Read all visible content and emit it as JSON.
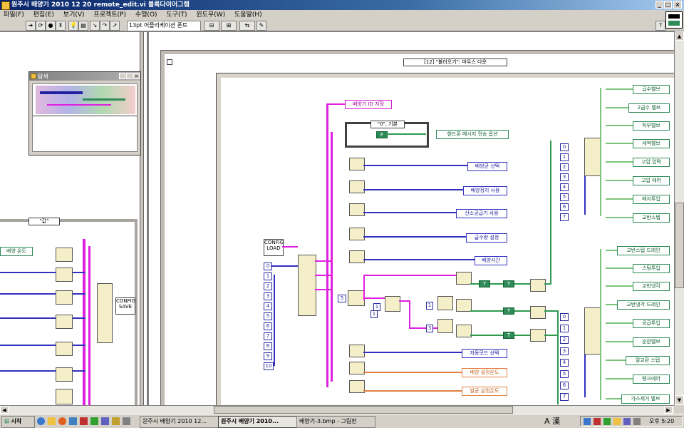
{
  "window": {
    "title": "원주시 배양기 2010 12 20 remote_edit.vi 블록다이어그램"
  },
  "menu": {
    "items": [
      "파일(F)",
      "편집(E)",
      "보기(V)",
      "프로젝트(P)",
      "수행(O)",
      "도구(T)",
      "윈도우(W)",
      "도움말(H)"
    ]
  },
  "toolbar": {
    "font_combo": "13pt 어플리케이션 폰트"
  },
  "nav_window": {
    "title": "탐색"
  },
  "diagram": {
    "left_case_selector": "\"값\"",
    "left_label_indicator": "배양 온도",
    "config_save": "CONFIG SAVE",
    "event_selector": "[12] \"불러오기\": 마우스 다운",
    "inner_case_selector": "\"0\", 기본",
    "config_load": "CONFIG LOAD",
    "indicators": {
      "id_setting": "배양기 ID 지정",
      "mobile_msg": "핸드폰 메시지 전송 옵션",
      "feed_select": "배양균 선택",
      "stir_use": "배양정지 사용",
      "oxygen_use": "산소공급기 사용",
      "feed_rate": "급수량 설정",
      "culture_time": "배양시간",
      "auto_select": "자동모드 선택",
      "culture_temp": "배양 설정온도",
      "growth_temp": "발균 설정온도"
    },
    "right_top_outputs": [
      "급수밸브",
      "2급수 밸브",
      "하부밸브",
      "세척밸브",
      "고압 압력",
      "고압 에어",
      "배지투입",
      "교반스텝"
    ],
    "right_bottom_outputs": [
      "교반스텝 드레인",
      "스팀투입",
      "교반냉각",
      "교반냉각 드레인",
      "공급투입",
      "순환밸브",
      "열교환 스텝",
      "탱크에어",
      "가스제거 밸브"
    ]
  },
  "taskbar": {
    "start": "시작",
    "tasks": [
      "원주시 배양기 2010 12...",
      "원주시 배양기 2010...",
      "배양기-3.bmp - 그림판"
    ],
    "lang": "A 漢",
    "clock": "오후 5:20"
  },
  "colors": {
    "pink_wire": "#e020e0",
    "blue_wire": "#3030c0",
    "green_wire": "#2e9b4f",
    "orange": "#e08040",
    "frame": "#404040",
    "titlebar": "#0a246a"
  }
}
